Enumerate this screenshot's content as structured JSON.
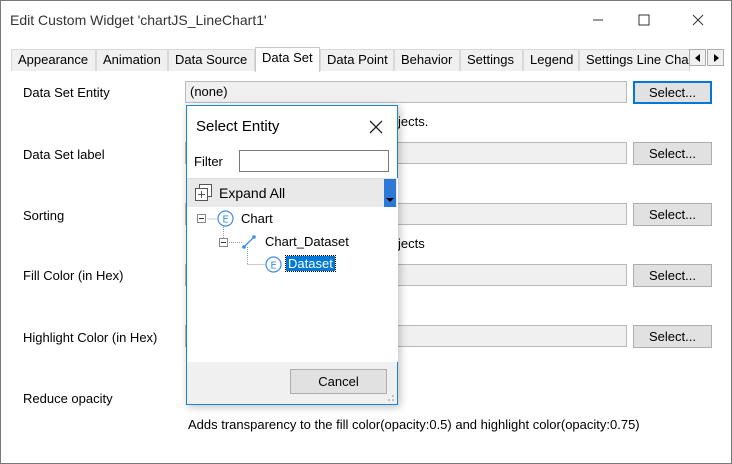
{
  "window": {
    "title": "Edit Custom Widget 'chartJS_LineChart1'"
  },
  "tabs": [
    "Appearance",
    "Animation",
    "Data Source",
    "Data Set",
    "Data Point",
    "Behavior",
    "Settings",
    "Legend",
    "Settings Line Cha"
  ],
  "active_tab": "Data Set",
  "form": {
    "rows": [
      {
        "label": "Data Set Entity",
        "value": "(none)",
        "button": "Select..."
      },
      {
        "label": "Data Set label",
        "value": "",
        "button": "Select..."
      },
      {
        "label": "Sorting",
        "value": "",
        "button": "Select..."
      },
      {
        "label": "Fill Color (in Hex)",
        "value": "",
        "button": "Select..."
      },
      {
        "label": "Highlight Color (in Hex)",
        "value": "",
        "button": "Select..."
      },
      {
        "label": "Reduce opacity"
      }
    ],
    "hint_objects": "jects.",
    "hint_objects2": "jects",
    "opacity_hint": "Adds transparency to the fill color(opacity:0.5) and highlight color(opacity:0.75)"
  },
  "dialog": {
    "title": "Select Entity",
    "filter_label": "Filter",
    "filter_value": "",
    "expand_all": "Expand All",
    "tree": {
      "root": "Chart",
      "association": "Chart_Dataset",
      "child": "Dataset"
    },
    "cancel": "Cancel"
  },
  "colors": {
    "accent": "#0078d7",
    "entity_icon": "#3a8ee6"
  }
}
